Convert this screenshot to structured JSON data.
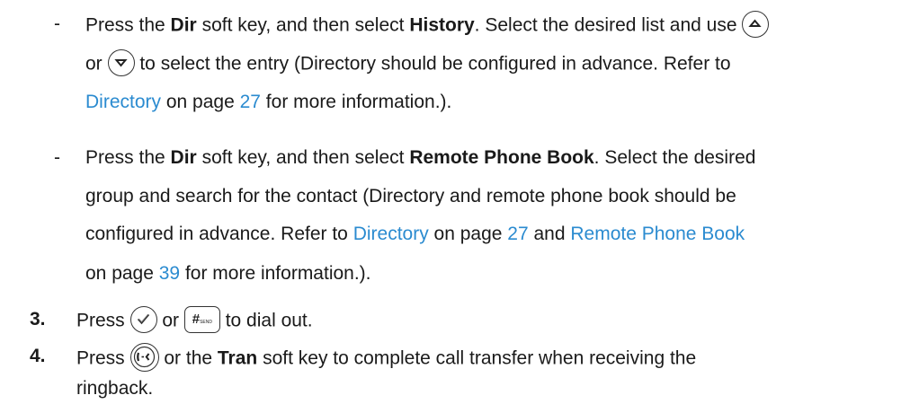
{
  "items": {
    "history": {
      "bullet": "-",
      "p1": "Press the ",
      "dir": "Dir",
      "p2": " soft key, and then select ",
      "history": "History",
      "p3": ". Select the desired list and use ",
      "p4": "or ",
      "p5": " to select the entry (Directory should be configured in advance. Refer to",
      "link_directory": "Directory",
      "p6": " on page ",
      "page": "27",
      "p7": " for more information.)."
    },
    "remote": {
      "bullet": "-",
      "p1": "Press the ",
      "dir": "Dir",
      "p2": " soft key, and then select ",
      "rpb": "Remote Phone Book",
      "p3": ". Select the desired",
      "line2": "group and search for the contact (Directory and remote phone book should be",
      "line3a": "configured in advance. Refer to ",
      "link_directory": "Directory",
      "p4": " on page ",
      "page1": "27",
      "p5": " and ",
      "link_rpb": "Remote Phone Book",
      "line4a": "on page ",
      "page2": "39",
      "line4b": " for more information.)."
    },
    "step3": {
      "num": "3.",
      "p1": "Press ",
      "or": " or ",
      "send_key": "#",
      "send_sub": "SEND",
      "p2": " to dial out."
    },
    "step4": {
      "num": "4.",
      "p1": "Press ",
      "p2": " or the ",
      "tran": "Tran",
      "p3": " soft key to complete call transfer when receiving the",
      "line2": "ringback."
    }
  },
  "icons": [
    "up-arrow-key-icon",
    "down-arrow-key-icon",
    "ok-checkmark-key-icon",
    "send-key-icon",
    "transfer-key-icon"
  ],
  "colors": {
    "text": "#1a1a1a",
    "link": "#2b8bd0"
  }
}
